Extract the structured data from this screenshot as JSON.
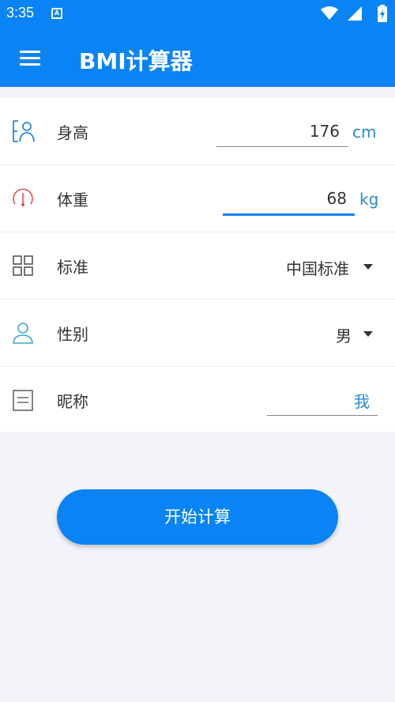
{
  "status_bar": {
    "time": "3:35",
    "notification_icon": "A"
  },
  "app_bar": {
    "title": "BMI计算器",
    "menu_icon": "hamburger-menu-icon"
  },
  "form": {
    "height": {
      "label": "身高",
      "value": "176",
      "unit": "cm",
      "icon": "person-height-icon"
    },
    "weight": {
      "label": "体重",
      "value": "68",
      "unit": "kg",
      "icon": "gauge-icon"
    },
    "standard": {
      "label": "标准",
      "value": "中国标准",
      "icon": "grid-icon"
    },
    "gender": {
      "label": "性别",
      "value": "男",
      "icon": "person-icon"
    },
    "nickname": {
      "label": "昵称",
      "value": "我",
      "icon": "note-icon"
    }
  },
  "actions": {
    "start_label": "开始计算"
  },
  "colors": {
    "primary": "#0a84f5",
    "background": "#f3f4f8",
    "unit_text": "#2a88d8",
    "weight_icon": "#d9534f",
    "height_icon": "#2a88d8",
    "gender_icon": "#3aa7c9"
  }
}
